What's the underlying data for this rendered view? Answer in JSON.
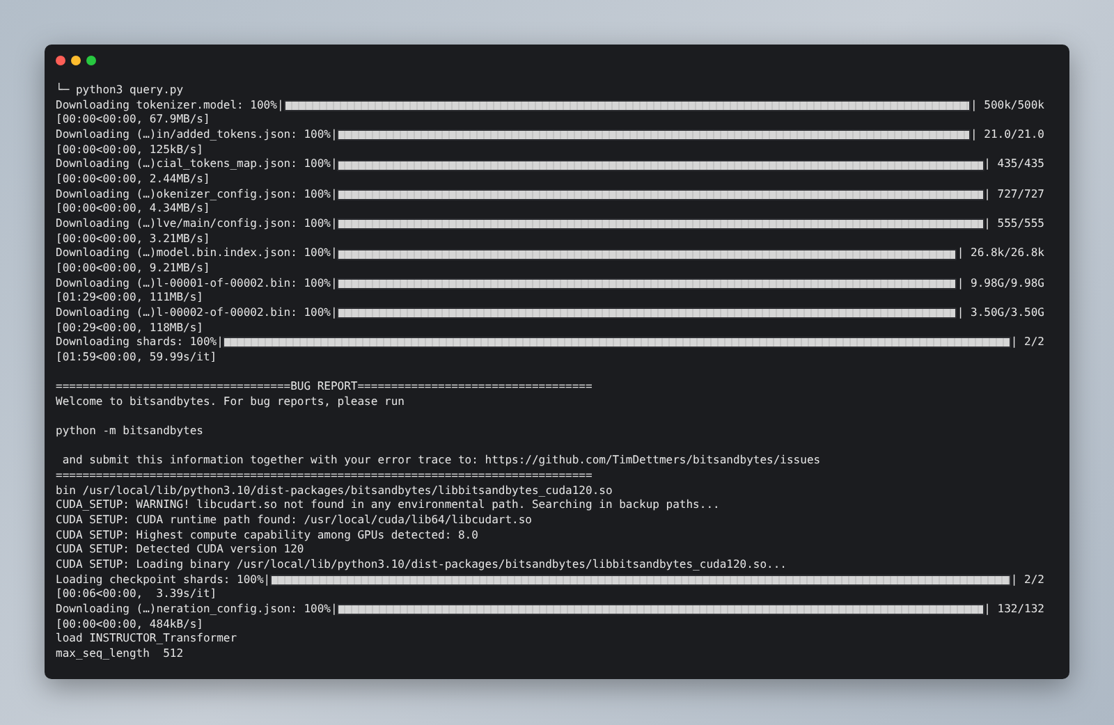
{
  "terminal": {
    "lines": [
      {
        "kind": "text",
        "text": "└─ python3 query.py"
      },
      {
        "kind": "progress",
        "label": "Downloading tokenizer.model: 100%|",
        "level": 1,
        "count": "| 500k/500k"
      },
      {
        "kind": "text",
        "text": "[00:00<00:00, 67.9MB/s]"
      },
      {
        "kind": "progress",
        "label": "Downloading (…)in/added_tokens.json: 100%|",
        "level": 1,
        "count": "| 21.0/21.0"
      },
      {
        "kind": "text",
        "text": "[00:00<00:00, 125kB/s]"
      },
      {
        "kind": "progress",
        "label": "Downloading (…)cial_tokens_map.json: 100%|",
        "level": 1,
        "count": "| 435/435"
      },
      {
        "kind": "text",
        "text": "[00:00<00:00, 2.44MB/s]"
      },
      {
        "kind": "progress",
        "label": "Downloading (…)okenizer_config.json: 100%|",
        "level": 1,
        "count": "| 727/727"
      },
      {
        "kind": "text",
        "text": "[00:00<00:00, 4.34MB/s]"
      },
      {
        "kind": "progress",
        "label": "Downloading (…)lve/main/config.json: 100%|",
        "level": 1,
        "count": "| 555/555"
      },
      {
        "kind": "text",
        "text": "[00:00<00:00, 3.21MB/s]"
      },
      {
        "kind": "progress",
        "label": "Downloading (…)model.bin.index.json: 100%|",
        "level": 1,
        "count": "| 26.8k/26.8k"
      },
      {
        "kind": "text",
        "text": "[00:00<00:00, 9.21MB/s]"
      },
      {
        "kind": "progress",
        "label": "Downloading (…)l-00001-of-00002.bin: 100%|",
        "level": 1,
        "count": "| 9.98G/9.98G"
      },
      {
        "kind": "text",
        "text": "[01:29<00:00, 111MB/s]"
      },
      {
        "kind": "progress",
        "label": "Downloading (…)l-00002-of-00002.bin: 100%|",
        "level": 1,
        "count": "| 3.50G/3.50G"
      },
      {
        "kind": "text",
        "text": "[00:29<00:00, 118MB/s]"
      },
      {
        "kind": "progress",
        "label": "Downloading shards: 100%|",
        "level": 1,
        "count": "| 2/2"
      },
      {
        "kind": "text",
        "text": "[01:59<00:00, 59.99s/it]"
      },
      {
        "kind": "blank"
      },
      {
        "kind": "text",
        "text": "===================================BUG REPORT==================================="
      },
      {
        "kind": "text",
        "text": "Welcome to bitsandbytes. For bug reports, please run"
      },
      {
        "kind": "blank"
      },
      {
        "kind": "text",
        "text": "python -m bitsandbytes"
      },
      {
        "kind": "blank"
      },
      {
        "kind": "text",
        "text": " and submit this information together with your error trace to: https://github.com/TimDettmers/bitsandbytes/issues"
      },
      {
        "kind": "text",
        "text": "================================================================================"
      },
      {
        "kind": "text",
        "text": "bin /usr/local/lib/python3.10/dist-packages/bitsandbytes/libbitsandbytes_cuda120.so"
      },
      {
        "kind": "text",
        "text": "CUDA_SETUP: WARNING! libcudart.so not found in any environmental path. Searching in backup paths..."
      },
      {
        "kind": "text",
        "text": "CUDA SETUP: CUDA runtime path found: /usr/local/cuda/lib64/libcudart.so"
      },
      {
        "kind": "text",
        "text": "CUDA SETUP: Highest compute capability among GPUs detected: 8.0"
      },
      {
        "kind": "text",
        "text": "CUDA SETUP: Detected CUDA version 120"
      },
      {
        "kind": "text",
        "text": "CUDA SETUP: Loading binary /usr/local/lib/python3.10/dist-packages/bitsandbytes/libbitsandbytes_cuda120.so..."
      },
      {
        "kind": "progress",
        "label": "Loading checkpoint shards: 100%|",
        "level": 1,
        "count": "| 2/2"
      },
      {
        "kind": "text",
        "text": "[00:06<00:00,  3.39s/it]"
      },
      {
        "kind": "progress",
        "label": "Downloading (…)neration_config.json: 100%|",
        "level": 1,
        "count": "| 132/132"
      },
      {
        "kind": "text",
        "text": "[00:00<00:00, 484kB/s]"
      },
      {
        "kind": "text",
        "text": "load INSTRUCTOR_Transformer"
      },
      {
        "kind": "text",
        "text": "max_seq_length  512"
      }
    ]
  }
}
